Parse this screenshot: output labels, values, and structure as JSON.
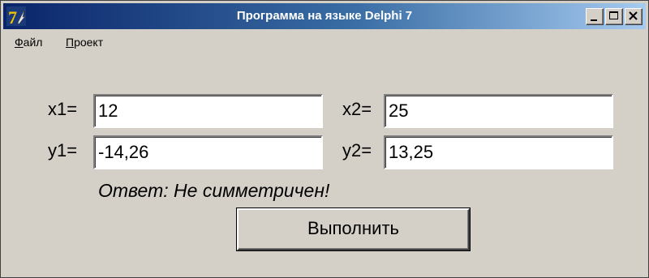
{
  "window": {
    "title": "Программа на языке Delphi 7",
    "icon": "delphi-7-icon"
  },
  "menu": {
    "file": {
      "accel": "Ф",
      "rest": "айл"
    },
    "project": {
      "accel": "П",
      "rest": "роект"
    }
  },
  "fields": {
    "x1": {
      "label": "x1=",
      "value": "12"
    },
    "x2": {
      "label": "x2=",
      "value": "25"
    },
    "y1": {
      "label": "y1=",
      "value": "-14,26"
    },
    "y2": {
      "label": "y2=",
      "value": "13,25"
    }
  },
  "answer": "Ответ: Не симметричен!",
  "execute_label": "Выполнить",
  "colors": {
    "face": "#d4d0c8",
    "titlebar_start": "#0a246a",
    "titlebar_end": "#a6caf0"
  }
}
